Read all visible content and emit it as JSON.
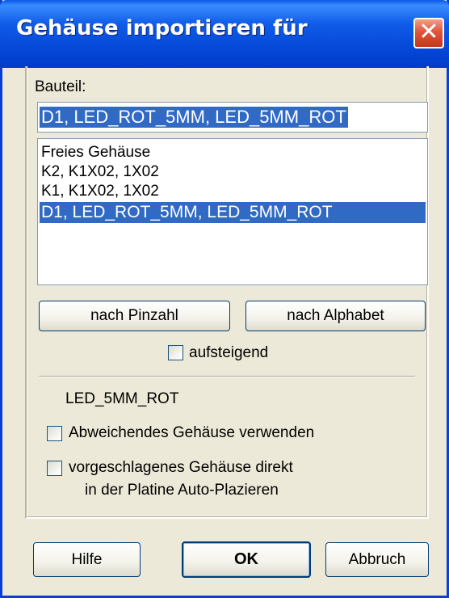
{
  "window": {
    "title": "Gehäuse importieren für",
    "close_label": "✕"
  },
  "part": {
    "label": "Bauteil:",
    "current_value": "D1, LED_ROT_5MM, LED_5MM_ROT",
    "list": [
      {
        "text": "Freies Gehäuse",
        "selected": false
      },
      {
        "text": "K2, K1X02, 1X02",
        "selected": false
      },
      {
        "text": "K1, K1X02, 1X02",
        "selected": false
      },
      {
        "text": "D1, LED_ROT_5MM, LED_5MM_ROT",
        "selected": true
      }
    ]
  },
  "sort": {
    "by_pins_label": "nach Pinzahl",
    "by_alpha_label": "nach Alphabet",
    "ascending_label": "aufsteigend",
    "ascending_checked": false
  },
  "package": {
    "name": "LED_5MM_ROT",
    "use_different_label": "Abweichendes Gehäuse verwenden",
    "use_different_checked": false,
    "auto_place_label_line1": "vorgeschlagenes Gehäuse direkt",
    "auto_place_label_line2": "in der Platine Auto-Plazieren",
    "auto_place_checked": false
  },
  "footer": {
    "help_label": "Hilfe",
    "ok_label": "OK",
    "cancel_label": "Abbruch"
  },
  "colors": {
    "titlebar": "#0546d6",
    "selection": "#316ac5",
    "dialog_bg": "#ece9d8"
  }
}
